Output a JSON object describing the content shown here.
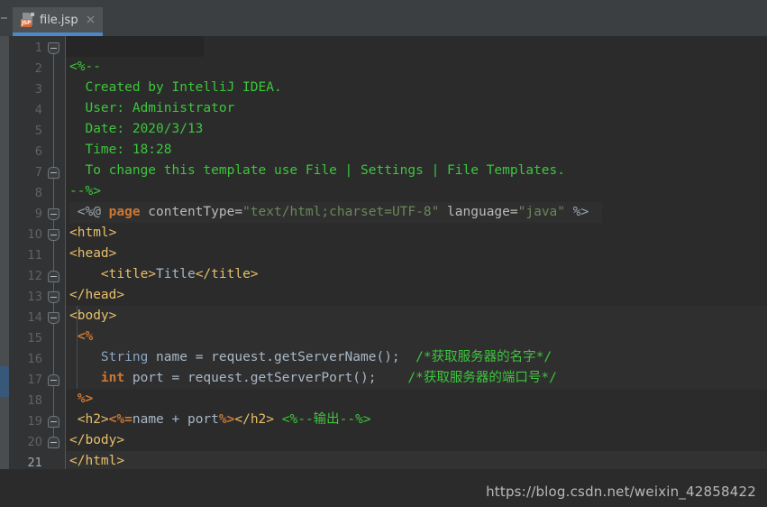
{
  "window": {
    "background_color": "#2b2b2b",
    "chrome_color": "#3c3f41"
  },
  "tabbar": {
    "tab": {
      "label": "file.jsp",
      "icon_name": "jsp-file-icon",
      "icon_badge": "JSP",
      "close_label": "×",
      "active": true,
      "underline_color": "#4a88c7"
    }
  },
  "editor": {
    "line_numbers": [
      "1",
      "2",
      "3",
      "4",
      "5",
      "6",
      "7",
      "8",
      "9",
      "10",
      "11",
      "12",
      "13",
      "14",
      "15",
      "16",
      "17",
      "18",
      "19",
      "20",
      "21"
    ],
    "current_line": "21",
    "lines": [
      {
        "n": 1,
        "indent": 0,
        "tokens": [
          {
            "c": "t-comment",
            "t": "<%--"
          }
        ]
      },
      {
        "n": 2,
        "indent": 0,
        "tokens": [
          {
            "c": "t-comment",
            "t": "  Created by IntelliJ IDEA."
          }
        ]
      },
      {
        "n": 3,
        "indent": 0,
        "tokens": [
          {
            "c": "t-comment",
            "t": "  User: Administrator"
          }
        ]
      },
      {
        "n": 4,
        "indent": 0,
        "tokens": [
          {
            "c": "t-comment",
            "t": "  Date: 2020/3/13"
          }
        ]
      },
      {
        "n": 5,
        "indent": 0,
        "tokens": [
          {
            "c": "t-comment",
            "t": "  Time: 18:28"
          }
        ]
      },
      {
        "n": 6,
        "indent": 0,
        "tokens": [
          {
            "c": "t-comment",
            "t": "  To change this template use File | Settings | File Templates."
          }
        ]
      },
      {
        "n": 7,
        "indent": 0,
        "tokens": [
          {
            "c": "t-comment",
            "t": "--%>"
          }
        ]
      },
      {
        "n": 8,
        "indent": 0,
        "tokens": [
          {
            "c": "t-jsp",
            "t": " <%@ "
          },
          {
            "c": "t-kw",
            "t": "page"
          },
          {
            "c": "t-attr",
            "t": " contentType="
          },
          {
            "c": "t-val",
            "t": "\"text/html;charset=UTF-8\""
          },
          {
            "c": "t-attr",
            "t": " language="
          },
          {
            "c": "t-val",
            "t": "\"java\""
          },
          {
            "c": "t-jsp",
            "t": " %>"
          }
        ]
      },
      {
        "n": 9,
        "indent": 0,
        "tokens": [
          {
            "c": "t-tag",
            "t": "<html>"
          }
        ]
      },
      {
        "n": 10,
        "indent": 0,
        "tokens": [
          {
            "c": "t-tag",
            "t": "<head>"
          }
        ]
      },
      {
        "n": 11,
        "indent": 0,
        "tokens": [
          {
            "c": "t-tag",
            "t": "    <title>"
          },
          {
            "c": "t-text",
            "t": "Title"
          },
          {
            "c": "t-tag",
            "t": "</title>"
          }
        ]
      },
      {
        "n": 12,
        "indent": 0,
        "tokens": [
          {
            "c": "t-tag",
            "t": "</head>"
          }
        ]
      },
      {
        "n": 13,
        "indent": 0,
        "tokens": [
          {
            "c": "t-tag",
            "t": "<body>"
          }
        ]
      },
      {
        "n": 14,
        "indent": 0,
        "tokens": [
          {
            "c": "t-kw",
            "t": " <%"
          }
        ]
      },
      {
        "n": 15,
        "indent": 0,
        "tokens": [
          {
            "c": "t-type",
            "t": "    String"
          },
          {
            "c": "t-ident",
            "t": " name = request.getServerName();"
          },
          {
            "c": "t-comment",
            "t": "  /*获取服务器的名字*/"
          }
        ]
      },
      {
        "n": 16,
        "indent": 0,
        "tokens": [
          {
            "c": "t-kw",
            "t": "    int"
          },
          {
            "c": "t-ident",
            "t": " port = request.getServerPort();"
          },
          {
            "c": "t-comment",
            "t": "    /*获取服务器的端口号*/"
          }
        ]
      },
      {
        "n": 17,
        "indent": 0,
        "tokens": [
          {
            "c": "t-kw",
            "t": " %>"
          }
        ]
      },
      {
        "n": 18,
        "indent": 0,
        "tokens": [
          {
            "c": "t-tag",
            "t": " <h2>"
          },
          {
            "c": "t-kw",
            "t": "<%="
          },
          {
            "c": "t-ident",
            "t": "name + port"
          },
          {
            "c": "t-kw",
            "t": "%>"
          },
          {
            "c": "t-tag",
            "t": "</h2>"
          },
          {
            "c": "t-text",
            "t": " "
          },
          {
            "c": "t-comment",
            "t": "<%--输出--%>"
          }
        ]
      },
      {
        "n": 19,
        "indent": 0,
        "tokens": [
          {
            "c": "t-tag",
            "t": "</body>"
          }
        ]
      },
      {
        "n": 20,
        "indent": 0,
        "tokens": [
          {
            "c": "t-tag",
            "t": "</html>"
          }
        ]
      },
      {
        "n": 21,
        "indent": 0,
        "tokens": [
          {
            "c": "t-text",
            "t": ""
          }
        ]
      }
    ],
    "fold_markers": [
      {
        "line": 1,
        "type": "open"
      },
      {
        "line": 7,
        "type": "close"
      },
      {
        "line": 9,
        "type": "open"
      },
      {
        "line": 10,
        "type": "open"
      },
      {
        "line": 12,
        "type": "close"
      },
      {
        "line": 13,
        "type": "open"
      },
      {
        "line": 14,
        "type": "open"
      },
      {
        "line": 17,
        "type": "close"
      },
      {
        "line": 19,
        "type": "close"
      },
      {
        "line": 20,
        "type": "close"
      }
    ]
  },
  "watermark": {
    "text": "https://blog.csdn.net/weixin_42858422"
  }
}
